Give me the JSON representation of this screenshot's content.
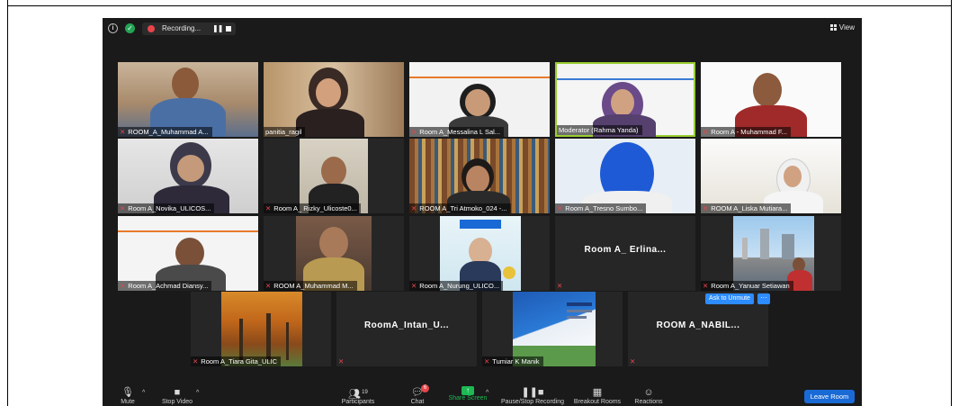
{
  "window": {
    "recording_label": "Recording...",
    "view_label": "View",
    "ask_to_unmute": "Ask to Unmute",
    "more": "···"
  },
  "participants": [
    {
      "name": "ROOM_A_Muhammad A..."
    },
    {
      "name": "panitia_ragil"
    },
    {
      "name": "Room A_Messalina L Sal..."
    },
    {
      "name": "Moderator (Rahma Yanda)"
    },
    {
      "name": "Room A - Muhammad F..."
    },
    {
      "name": "Room A_Novika_ULICOS..."
    },
    {
      "name": "Room A_ Rizky_Ulicoste0..."
    },
    {
      "name": "ROOM A_Tri Atmoko_024 -..."
    },
    {
      "name": "Room A_Tresno Sumbo..."
    },
    {
      "name": "ROOM A_Liska Mutiara..."
    },
    {
      "name": "Room A_Achmad Diansy..."
    },
    {
      "name": "ROOM A_Muhammad M..."
    },
    {
      "name": "Room A_Nurung_ULICO..."
    },
    {
      "name": "Room A_Erlina...",
      "big": "Room A_ Erlina..."
    },
    {
      "name": "Room A_Yanuar Setiawan"
    },
    {
      "name": "Room A_Tiara Gita_ULIC"
    },
    {
      "name": "RoomA_Intan_U...",
      "big": "RoomA_Intan_U..."
    },
    {
      "name": "Tumiar K Manik"
    },
    {
      "name": "ROOM A_NABIL...",
      "big": "ROOM A_NABIL..."
    }
  ],
  "toolbar": {
    "mute": "Mute",
    "stop_video": "Stop Video",
    "participants": "Participants",
    "participants_count": "19",
    "chat": "Chat",
    "chat_badge": "6",
    "share_screen": "Share Screen",
    "pause_recording": "Pause/Stop Recording",
    "breakout_rooms": "Breakout Rooms",
    "reactions": "Reactions",
    "leave": "Leave Room"
  },
  "colors": {
    "accent_blue": "#2d8cff",
    "leave_blue": "#1a6ad6",
    "recording_red": "#e8454b",
    "share_green": "#1db954",
    "speaker_border": "#9acd32"
  }
}
